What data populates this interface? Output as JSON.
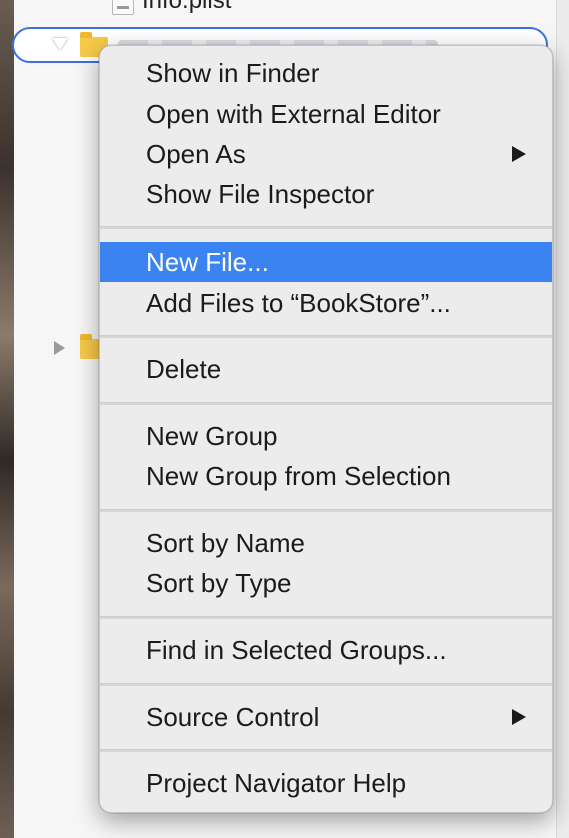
{
  "navigator": {
    "top_file": {
      "name": "Info.plist",
      "icon": "plist-file-icon"
    },
    "selected_folder": {
      "icon": "folder-icon"
    },
    "other_folder": {
      "icon": "folder-icon"
    }
  },
  "context_menu": {
    "groups": [
      [
        {
          "label": "Show in Finder"
        },
        {
          "label": "Open with External Editor"
        },
        {
          "label": "Open As",
          "submenu": true
        },
        {
          "label": "Show File Inspector"
        }
      ],
      [
        {
          "label": "New File...",
          "highlighted": true
        },
        {
          "label": "Add Files to “BookStore”..."
        }
      ],
      [
        {
          "label": "Delete"
        }
      ],
      [
        {
          "label": "New Group"
        },
        {
          "label": "New Group from Selection"
        }
      ],
      [
        {
          "label": "Sort by Name"
        },
        {
          "label": "Sort by Type"
        }
      ],
      [
        {
          "label": "Find in Selected Groups..."
        }
      ],
      [
        {
          "label": "Source Control",
          "submenu": true
        }
      ],
      [
        {
          "label": "Project Navigator Help"
        }
      ]
    ],
    "highlight_color": "#3b83f0",
    "selection_outline_color": "#3d6fe0"
  }
}
